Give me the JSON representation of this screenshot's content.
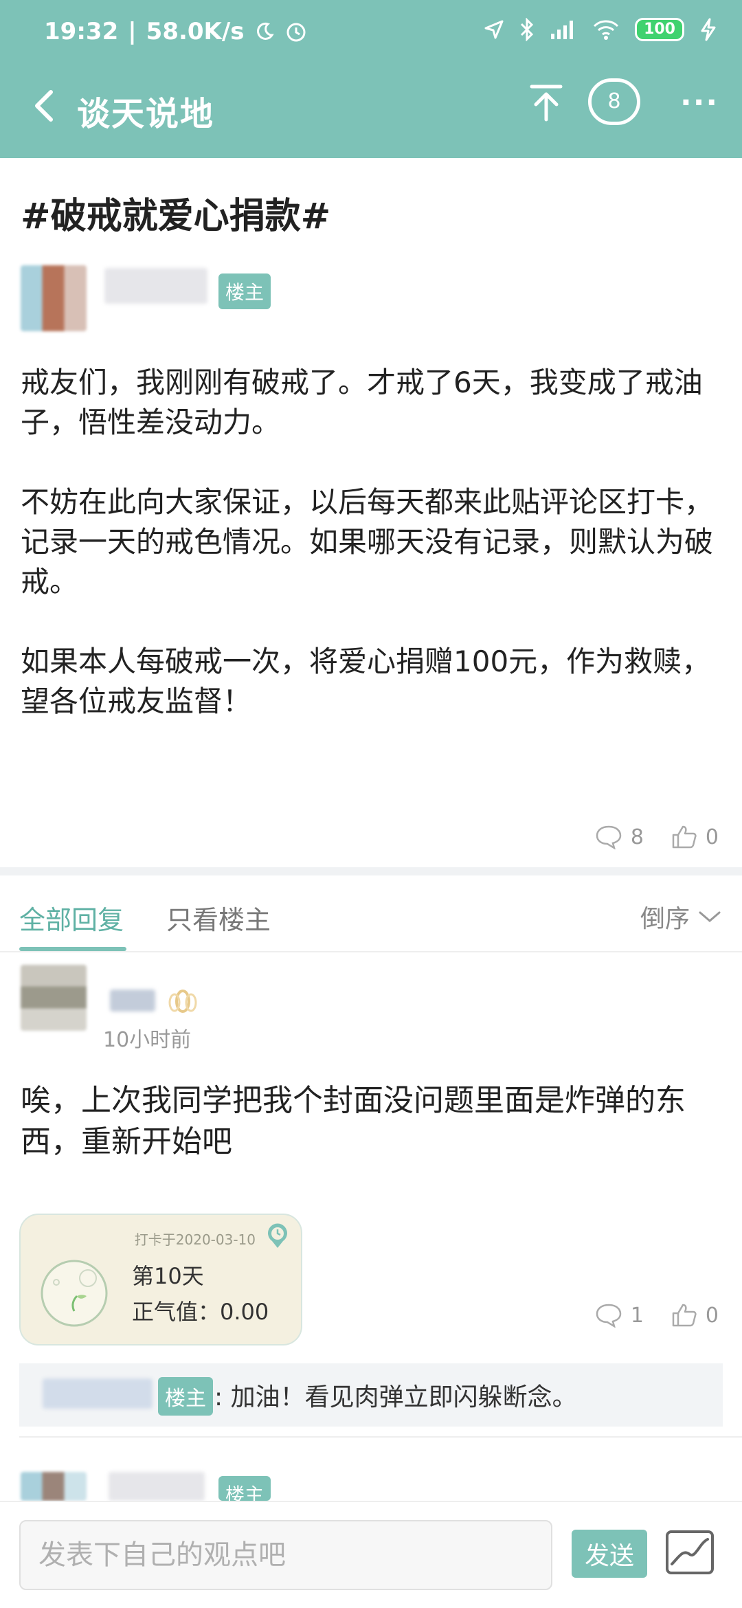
{
  "status_bar": {
    "time": "19:32",
    "speed": "58.0K/s",
    "battery": "100"
  },
  "header": {
    "title": "谈天说地",
    "comment_count": "8"
  },
  "post": {
    "title": "#破戒就爱心捐款#",
    "op_tag": "楼主",
    "body": "戒友们，我刚刚有破戒了。才戒了6天，我变成了戒油子，悟性差没动力。\n\n不妨在此向大家保证，以后每天都来此贴评论区打卡，记录一天的戒色情况。如果哪天没有记录，则默认为破戒。\n\n如果本人每破戒一次，将爱心捐赠100元，作为救赎，望各位戒友监督！",
    "comments": "8",
    "likes": "0"
  },
  "tabs": {
    "all_replies": "全部回复",
    "op_only": "只看楼主",
    "sort": "倒序"
  },
  "reply": {
    "time": "10小时前",
    "text": "唉，上次我同学把我个封面没问题里面是炸弹的东西，重新开始吧",
    "checkin": {
      "date": "打卡于2020-03-10",
      "day": "第10天",
      "score": "正气值：0.00"
    },
    "comments": "1",
    "likes": "0",
    "sub_reply": {
      "tag": "楼主",
      "text": ": 加油！看见肉弹立即闪躲断念。"
    }
  },
  "next_reply": {
    "op_tag": "楼主"
  },
  "input": {
    "placeholder": "发表下自己的观点吧",
    "send_label": "发送"
  },
  "colors": {
    "accent": "#7dc2b7",
    "accent_text": "#5fb1a4"
  }
}
